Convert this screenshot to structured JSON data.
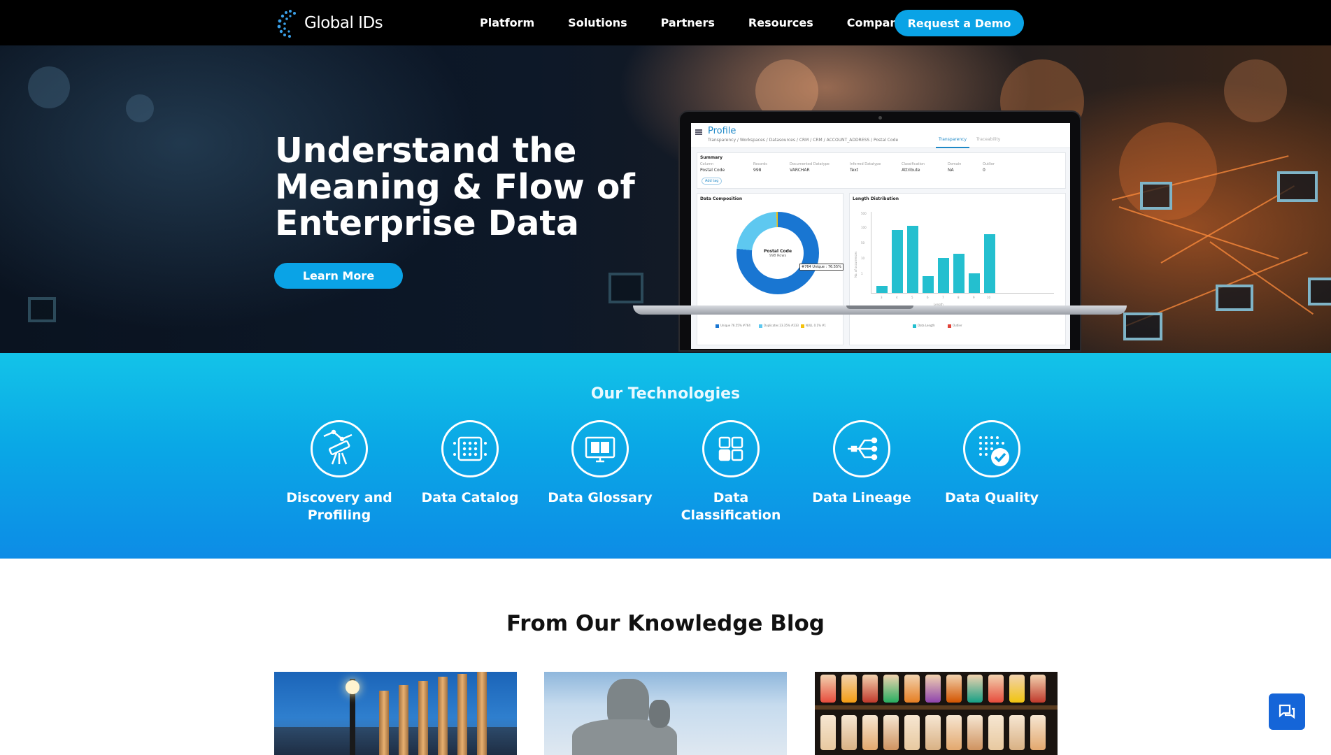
{
  "nav": {
    "logo_text": "Global IDs",
    "links": [
      "Platform",
      "Solutions",
      "Partners",
      "Resources",
      "Company"
    ],
    "demo_label": "Request a Demo"
  },
  "hero": {
    "title_lines": [
      "Understand the",
      "Meaning & Flow of",
      "Enterprise Data"
    ],
    "cta_label": "Learn More"
  },
  "screen": {
    "title": "Profile",
    "breadcrumb": "Transparency / Workspaces / Datasources / CRM / CRM / ACCOUNT_ADDRESS / Postal Code",
    "tabs": [
      "Transparency",
      "Traceability"
    ],
    "summary_title": "Summary",
    "summary_cols": [
      {
        "label": "Column",
        "value": "Postal Code"
      },
      {
        "label": "Records",
        "value": "998"
      },
      {
        "label": "Documented Datatype",
        "value": "VARCHAR"
      },
      {
        "label": "Inferred Datatype",
        "value": "Text"
      },
      {
        "label": "Classification",
        "value": "Attribute"
      },
      {
        "label": "Domain",
        "value": "NA"
      },
      {
        "label": "Outlier",
        "value": "0"
      }
    ],
    "add_tag": "Add tag",
    "composition_title": "Data Composition",
    "donut_label": "Postal Code",
    "donut_sub": "998 Rows",
    "donut_tip": "#764 Unique : 76.55%",
    "composition_legend": [
      "Unique 76.55% #764",
      "Duplicates 23.35% #233",
      "NULL 0.1% #1"
    ],
    "length_title": "Length Distribution",
    "length_ylabel": "No. of occurrences",
    "length_xlabel": "Length",
    "length_legend": [
      "Data Length",
      "Outlier"
    ],
    "length_x": [
      "3",
      "4",
      "5",
      "6",
      "7",
      "8",
      "9",
      "10"
    ],
    "length_yticks": [
      "1",
      "10",
      "50",
      "100",
      "500"
    ]
  },
  "technologies": {
    "title": "Our Technologies",
    "items": [
      {
        "label": "Discovery and Profiling",
        "icon": "telescope-icon"
      },
      {
        "label": "Data Catalog",
        "icon": "catalog-grid-icon"
      },
      {
        "label": "Data Glossary",
        "icon": "monitor-book-icon"
      },
      {
        "label": "Data Classification",
        "icon": "classification-squares-icon"
      },
      {
        "label": "Data Lineage",
        "icon": "lineage-branch-icon"
      },
      {
        "label": "Data Quality",
        "icon": "quality-check-icon"
      }
    ]
  },
  "blog": {
    "title": "From Our Knowledge Blog"
  },
  "colors": {
    "accent": "#0aa3e6",
    "nav_bg": "#000000",
    "tech_band_top": "#13c3e8",
    "tech_band_bottom": "#0d8ce6",
    "chat_button": "#1565d8"
  }
}
